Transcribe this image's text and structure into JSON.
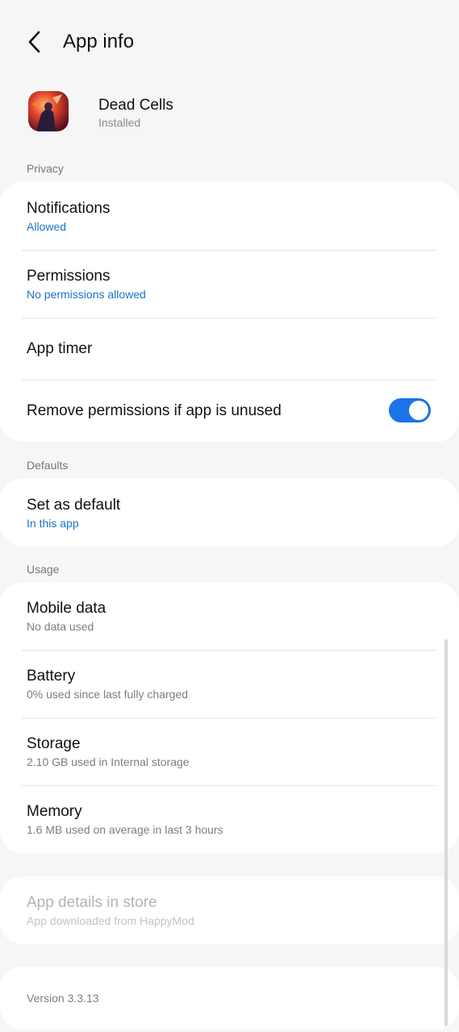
{
  "header": {
    "title": "App info",
    "back_icon": "chevron-left-icon"
  },
  "app": {
    "name": "Dead Cells",
    "status": "Installed"
  },
  "sections": {
    "privacy": {
      "label": "Privacy",
      "notifications": {
        "title": "Notifications",
        "sub": "Allowed"
      },
      "permissions": {
        "title": "Permissions",
        "sub": "No permissions allowed"
      },
      "app_timer": {
        "title": "App timer"
      },
      "remove_permissions": {
        "title": "Remove permissions if app is unused",
        "enabled": true
      }
    },
    "defaults": {
      "label": "Defaults",
      "set_default": {
        "title": "Set as default",
        "sub": "In this app"
      }
    },
    "usage": {
      "label": "Usage",
      "mobile_data": {
        "title": "Mobile data",
        "sub": "No data used"
      },
      "battery": {
        "title": "Battery",
        "sub": "0% used since last fully charged"
      },
      "storage": {
        "title": "Storage",
        "sub": "2.10 GB used in Internal storage"
      },
      "memory": {
        "title": "Memory",
        "sub": "1.6 MB used on average in last 3 hours"
      }
    },
    "store": {
      "title": "App details in store",
      "sub": "App downloaded from HappyMod"
    },
    "version": {
      "text": "Version 3.3.13"
    }
  },
  "colors": {
    "accent": "#1a73e8",
    "link": "#1a73c8",
    "background": "#f6f6f6",
    "card": "#ffffff"
  }
}
